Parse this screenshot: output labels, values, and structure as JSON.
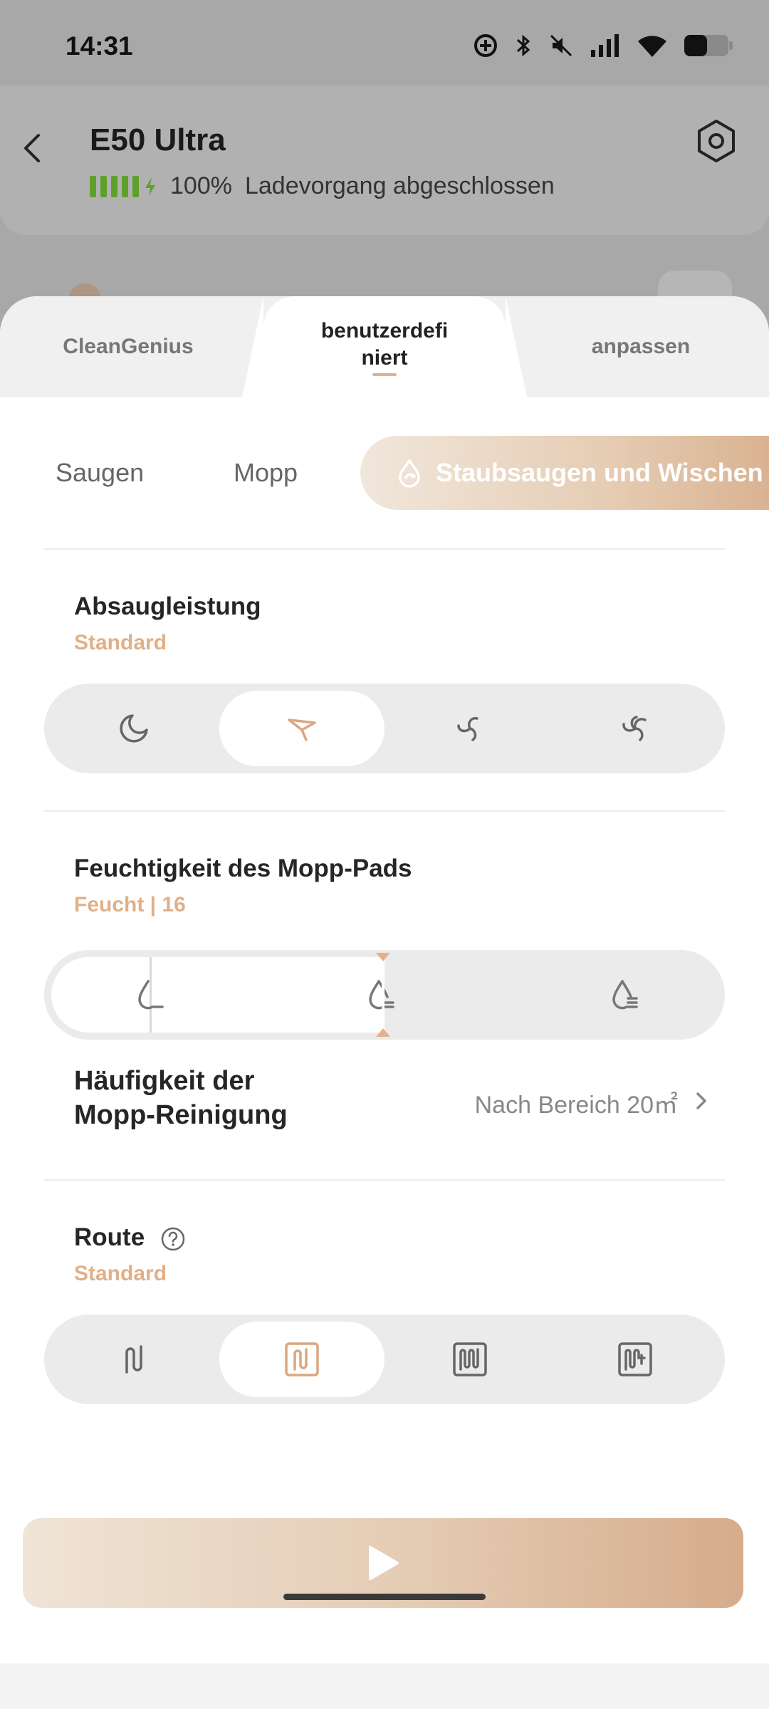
{
  "status_bar": {
    "time": "14:31",
    "icons": [
      "data-saver-icon",
      "bluetooth-icon",
      "mute-icon",
      "signal-icon",
      "wifi-icon",
      "battery-icon"
    ]
  },
  "header": {
    "device_name": "E50 Ultra",
    "battery_percent": "100%",
    "battery_level": 1.0,
    "battery_status": "Ladevorgang abgeschlossen",
    "back_icon": "chevron-left-icon",
    "settings_icon": "hex-gear-icon"
  },
  "tabs": [
    {
      "label": "CleanGenius",
      "active": false
    },
    {
      "label": "benutzerdefi\nniert",
      "line1": "benutzerdefi",
      "line2": "niert",
      "active": true
    },
    {
      "label": "anpassen",
      "active": false
    }
  ],
  "modes": [
    {
      "label": "Saugen",
      "active": false
    },
    {
      "label": "Mopp",
      "active": false
    },
    {
      "label": "Staubsaugen und Wischen",
      "active": true,
      "icon": "vacuum-mop-icon"
    }
  ],
  "suction": {
    "title": "Absaugleistung",
    "value": "Standard",
    "options": [
      "quiet-icon",
      "standard-fan-icon",
      "strong-fan-icon",
      "max-fan-icon"
    ],
    "selected_index": 1
  },
  "moisture": {
    "title": "Feuchtigkeit des Mopp-Pads",
    "value": "Feucht | 16",
    "levels": [
      "slightly-dry-drop-icon",
      "moist-drop-icon",
      "wet-drop-icon"
    ],
    "level_fraction": 0.5
  },
  "mop_frequency": {
    "title_line1": "Häufigkeit der",
    "title_line2": "Mopp-Reinigung",
    "value": "Nach Bereich 20㎡"
  },
  "route": {
    "title": "Route",
    "value": "Standard",
    "options": [
      "quick-route-icon",
      "standard-route-icon",
      "intensive-route-icon",
      "deep-route-icon"
    ],
    "selected_index": 1
  },
  "start_button": {
    "icon": "play-icon"
  },
  "colors": {
    "accent": "#e0b088",
    "battery_green": "#5ea12a",
    "gradient_start": "#f1e7dc",
    "gradient_end": "#d7ad8b"
  }
}
